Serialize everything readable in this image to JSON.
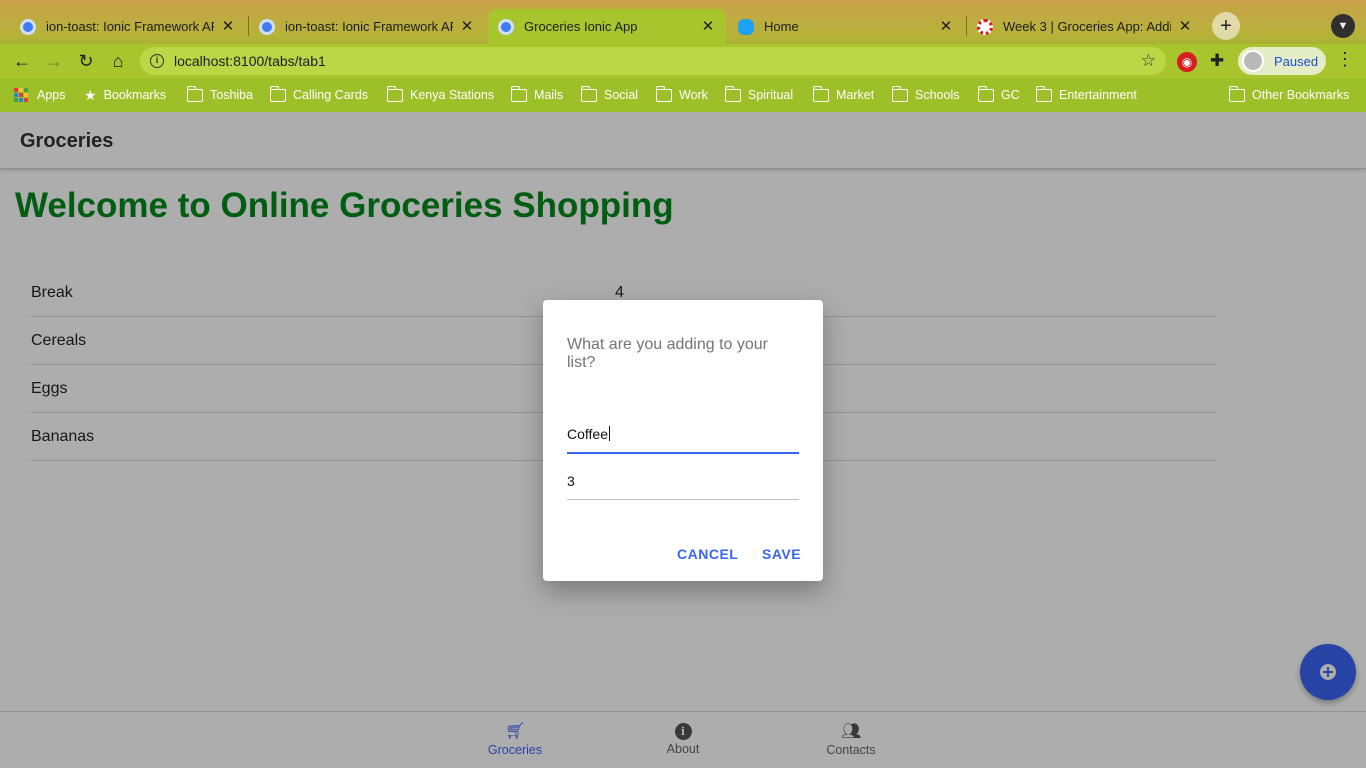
{
  "browser": {
    "tabs": [
      {
        "title": "ion-toast: Ionic Framework API",
        "favicon_color": "#3f7bf4",
        "active": false
      },
      {
        "title": "ion-toast: Ionic Framework API",
        "favicon_color": "#3f7bf4",
        "active": false
      },
      {
        "title": "Groceries Ionic App",
        "favicon_color": "#3f7bf4",
        "active": true
      },
      {
        "title": "Home",
        "favicon_color": "#1da1f2",
        "active": false
      },
      {
        "title": "Week 3 | Groceries App: Adding",
        "favicon_color": "#d81b1b",
        "active": false
      }
    ],
    "close_glyph": "✕",
    "new_tab_glyph": "+",
    "url": "localhost:8100/tabs/tab1",
    "profile_label": "Paused",
    "bookmarks": [
      {
        "label": "Apps",
        "icon": "apps-icon"
      },
      {
        "label": "Bookmarks",
        "icon": "star-icon"
      },
      {
        "label": "Toshiba",
        "icon": "folder-icon"
      },
      {
        "label": "Calling Cards",
        "icon": "folder-icon"
      },
      {
        "label": "Kenya Stations",
        "icon": "folder-icon"
      },
      {
        "label": "Mails",
        "icon": "folder-icon"
      },
      {
        "label": "Social",
        "icon": "folder-icon"
      },
      {
        "label": "Work",
        "icon": "folder-icon"
      },
      {
        "label": "Spiritual",
        "icon": "folder-icon"
      },
      {
        "label": "Market",
        "icon": "folder-icon"
      },
      {
        "label": "Schools",
        "icon": "folder-icon"
      },
      {
        "label": "GC",
        "icon": "folder-icon"
      },
      {
        "label": "Entertainment",
        "icon": "folder-icon"
      }
    ],
    "other_bookmarks": "Other Bookmarks"
  },
  "app": {
    "header_title": "Groceries",
    "welcome": "Welcome to Online Groceries Shopping",
    "items": [
      {
        "name": "Break",
        "qty": "4"
      },
      {
        "name": "Cereals",
        "qty": ""
      },
      {
        "name": "Eggs",
        "qty": ""
      },
      {
        "name": "Bananas",
        "qty": ""
      }
    ],
    "tabs": [
      {
        "label": "Groceries",
        "icon": "cart-icon",
        "selected": true
      },
      {
        "label": "About",
        "icon": "info-icon",
        "selected": false
      },
      {
        "label": "Contacts",
        "icon": "people-icon",
        "selected": false
      }
    ],
    "accent_color": "#3a64f5",
    "welcome_color": "#008a1a"
  },
  "dialog": {
    "message": "What are you adding to your list?",
    "name_value": "Coffee",
    "quantity_value": "3",
    "cancel_label": "CANCEL",
    "save_label": "SAVE"
  }
}
